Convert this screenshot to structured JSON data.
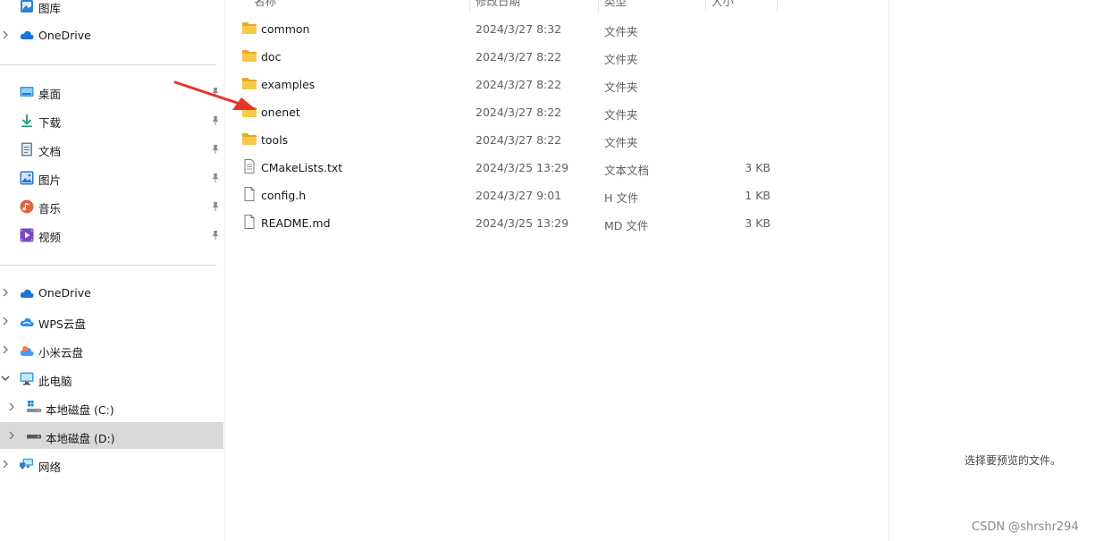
{
  "sidebar": {
    "quick_access": [
      {
        "label": "图库",
        "icon": "gallery-icon"
      },
      {
        "label": "OneDrive",
        "icon": "onedrive-cloud-icon"
      }
    ],
    "pinned": [
      {
        "label": "桌面",
        "icon": "desktop-icon"
      },
      {
        "label": "下载",
        "icon": "download-icon"
      },
      {
        "label": "文档",
        "icon": "document-icon"
      },
      {
        "label": "图片",
        "icon": "pictures-icon"
      },
      {
        "label": "音乐",
        "icon": "music-icon"
      },
      {
        "label": "视频",
        "icon": "video-icon"
      }
    ],
    "locations": [
      {
        "label": "OneDrive",
        "icon": "onedrive-cloud-icon"
      },
      {
        "label": "WPS云盘",
        "icon": "wps-cloud-icon"
      },
      {
        "label": "小米云盘",
        "icon": "xiaomi-cloud-icon"
      },
      {
        "label": "此电脑",
        "icon": "computer-icon"
      },
      {
        "label": "本地磁盘 (C:)",
        "icon": "windows-drive-icon"
      },
      {
        "label": "本地磁盘 (D:)",
        "icon": "drive-icon",
        "selected": true
      },
      {
        "label": "网络",
        "icon": "network-icon"
      }
    ]
  },
  "columns": {
    "name": "名称",
    "date": "修改日期",
    "type": "类型",
    "size": "大小"
  },
  "files": [
    {
      "name": "common",
      "date": "2024/3/27 8:32",
      "type": "文件夹",
      "size": "",
      "kind": "folder"
    },
    {
      "name": "doc",
      "date": "2024/3/27 8:22",
      "type": "文件夹",
      "size": "",
      "kind": "folder"
    },
    {
      "name": "examples",
      "date": "2024/3/27 8:22",
      "type": "文件夹",
      "size": "",
      "kind": "folder"
    },
    {
      "name": "onenet",
      "date": "2024/3/27 8:22",
      "type": "文件夹",
      "size": "",
      "kind": "folder"
    },
    {
      "name": "tools",
      "date": "2024/3/27 8:22",
      "type": "文件夹",
      "size": "",
      "kind": "folder"
    },
    {
      "name": "CMakeLists.txt",
      "date": "2024/3/25 13:29",
      "type": "文本文档",
      "size": "3 KB",
      "kind": "file"
    },
    {
      "name": "config.h",
      "date": "2024/3/27 9:01",
      "type": "H 文件",
      "size": "1 KB",
      "kind": "file"
    },
    {
      "name": "README.md",
      "date": "2024/3/25 13:29",
      "type": "MD 文件",
      "size": "3 KB",
      "kind": "file"
    }
  ],
  "preview": {
    "empty_text": "选择要预览的文件。"
  },
  "watermark": "CSDN @shrshr294",
  "colors": {
    "folder": "#f5c342",
    "accent": "#0f6cbd",
    "selected_bg": "#d9d9d9",
    "annotation_arrow": "#e8322a"
  }
}
